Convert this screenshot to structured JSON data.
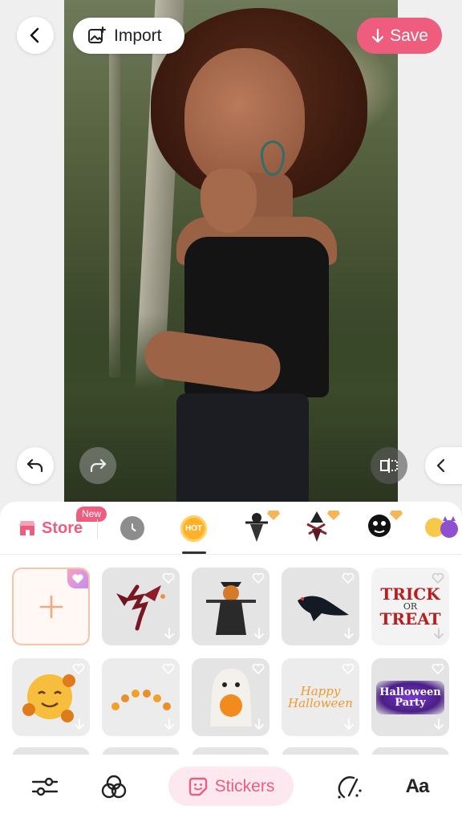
{
  "header": {
    "import_label": "Import",
    "save_label": "Save"
  },
  "panel": {
    "store_label": "Store",
    "new_badge": "New",
    "hot_label": "HOT"
  },
  "stickers": {
    "trick_line1": "TRICK",
    "trick_line2": "OR",
    "trick_line3": "TREAT",
    "happy_line1": "Happy",
    "happy_line2": "Halloween",
    "party_line1": "Halloween",
    "party_line2": "Party"
  },
  "nav": {
    "stickers_label": "Stickers",
    "text_label": "Aa"
  },
  "colors": {
    "accent": "#ee5c7e",
    "pill_bg": "#fde8ef",
    "hot": "#ffb12a"
  },
  "icons": [
    "back-icon",
    "image-plus-icon",
    "download-arrow-icon",
    "undo-icon",
    "redo-icon",
    "compare-icon",
    "chevron-left-icon",
    "store-icon",
    "clock-icon",
    "heart-icon",
    "adjust-icon",
    "filters-icon",
    "sticker-icon",
    "brush-icon"
  ]
}
